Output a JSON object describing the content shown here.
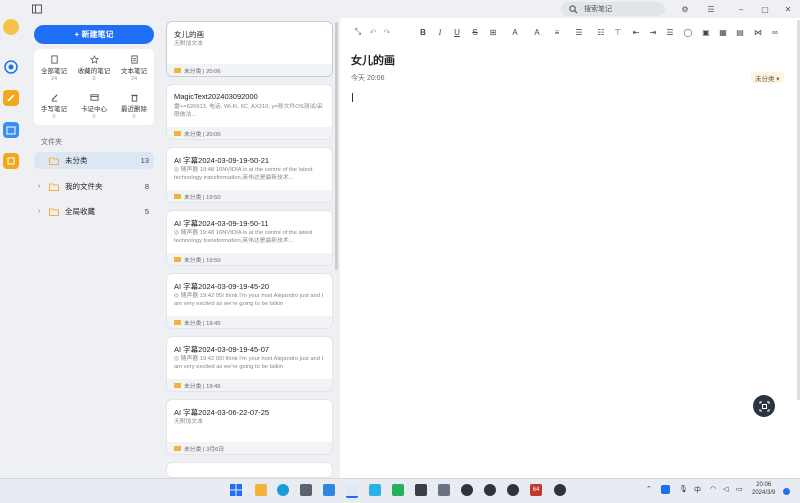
{
  "search": {
    "placeholder": "搜索笔记"
  },
  "nav": {
    "new_note": "+ 新建笔记",
    "categories": [
      {
        "label": "全部笔记",
        "count": "24"
      },
      {
        "label": "收藏的笔记",
        "count": "0"
      },
      {
        "label": "文本笔记",
        "count": "24"
      },
      {
        "label": "手写笔记",
        "count": "0"
      },
      {
        "label": "卡证中心",
        "count": "0"
      },
      {
        "label": "最近删除",
        "count": "0"
      }
    ],
    "folder_section": "文件夹",
    "folders": [
      {
        "label": "未分类",
        "count": "13"
      },
      {
        "label": "我的文件夹",
        "count": "8"
      },
      {
        "label": "全局收藏",
        "count": "5"
      }
    ]
  },
  "notes": [
    {
      "title": "女儿的画",
      "preview": "无附加文本",
      "meta": "未分类 | 20:06"
    },
    {
      "title": "MagicText202403092000",
      "preview": "雷+=626913, 电话, Wi-Fi, 6C, AX210, y=账文件OS测试/采限做法...",
      "meta": "未分类 | 20:00"
    },
    {
      "title": "AI 字幕2024-03-09-19-50-21",
      "preview": "◎ 随声器 19:48 16NVIDIA is at the centre of the latest technology transformation,英伟达是最新技术...",
      "meta": "未分类 | 19:50"
    },
    {
      "title": "AI 字幕2024-03-09-19-50-11",
      "preview": "◎ 随声器 19:48 16NVIDIA is at the centre of the latest technology transformation,英伟达是最新技术...",
      "meta": "未分类 | 19:50"
    },
    {
      "title": "AI 字幕2024-03-09-19-45-20",
      "preview": "◎ 随声器 19:42 05I think I'm your host Alejandro just and I am very excited as we're going to be talkin",
      "meta": "未分类 | 19:45"
    },
    {
      "title": "AI 字幕2024-03-09-19-45-07",
      "preview": "◎ 随声器 19:42 05I think I'm your host Alejandro just and I am very excited as we're going to be talkin",
      "meta": "未分类 | 19:45"
    },
    {
      "title": "AI 字幕2024-03-06-22-07-25",
      "preview": "无附加文本",
      "meta": "未分类 | 3月6日"
    }
  ],
  "editor": {
    "title": "女儿的画",
    "time": "今天 20:06",
    "category": "未分类 ▾"
  },
  "taskbar": {
    "ime": "中",
    "time": "20:06",
    "date": "2024/3/9",
    "app_badge": "64"
  },
  "colors": {
    "accent": "#1e6ff5",
    "folder": "#f3b23a"
  }
}
